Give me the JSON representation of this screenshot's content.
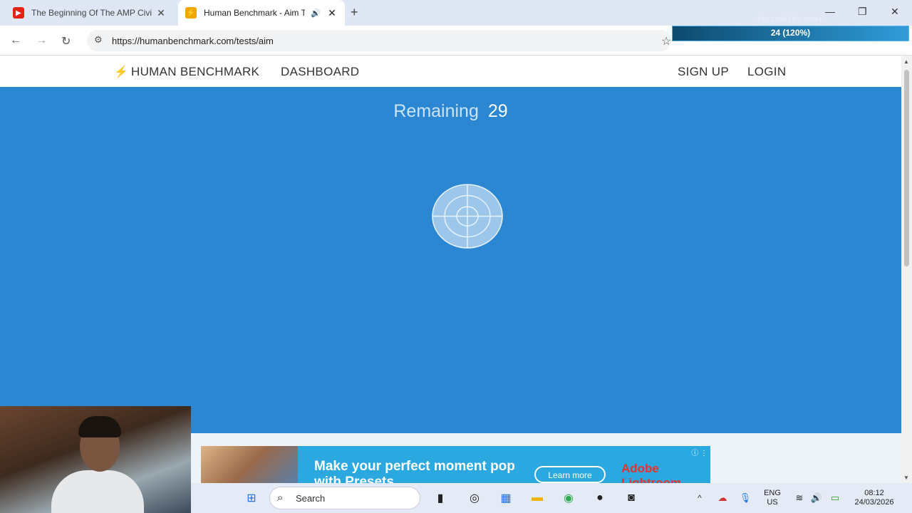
{
  "tabs": [
    {
      "title": "The Beginning Of The AMP Civi",
      "active": false
    },
    {
      "title": "Human Benchmark - Aim Tr",
      "active": true
    }
  ],
  "followers_overlay": {
    "label": "FOLLOWERS GOAL",
    "value": "24 (120%)"
  },
  "address_bar": {
    "url": "https://humanbenchmark.com/tests/aim"
  },
  "site_nav": {
    "brand": "HUMAN BENCHMARK",
    "dashboard": "DASHBOARD",
    "signup": "SIGN UP",
    "login": "LOGIN"
  },
  "game": {
    "remaining_label": "Remaining",
    "remaining_count": "29"
  },
  "ad": {
    "headline": "Make your perfect moment pop with Presets",
    "cta": "Learn more",
    "brand": "Adobe Lightroom"
  },
  "taskbar": {
    "search_placeholder": "Search",
    "language": "ENG",
    "region": "US",
    "time": "08:12",
    "date": "24/03/2026"
  },
  "colors": {
    "play_area": "#2b87d1",
    "accent": "#2ba8e0"
  }
}
